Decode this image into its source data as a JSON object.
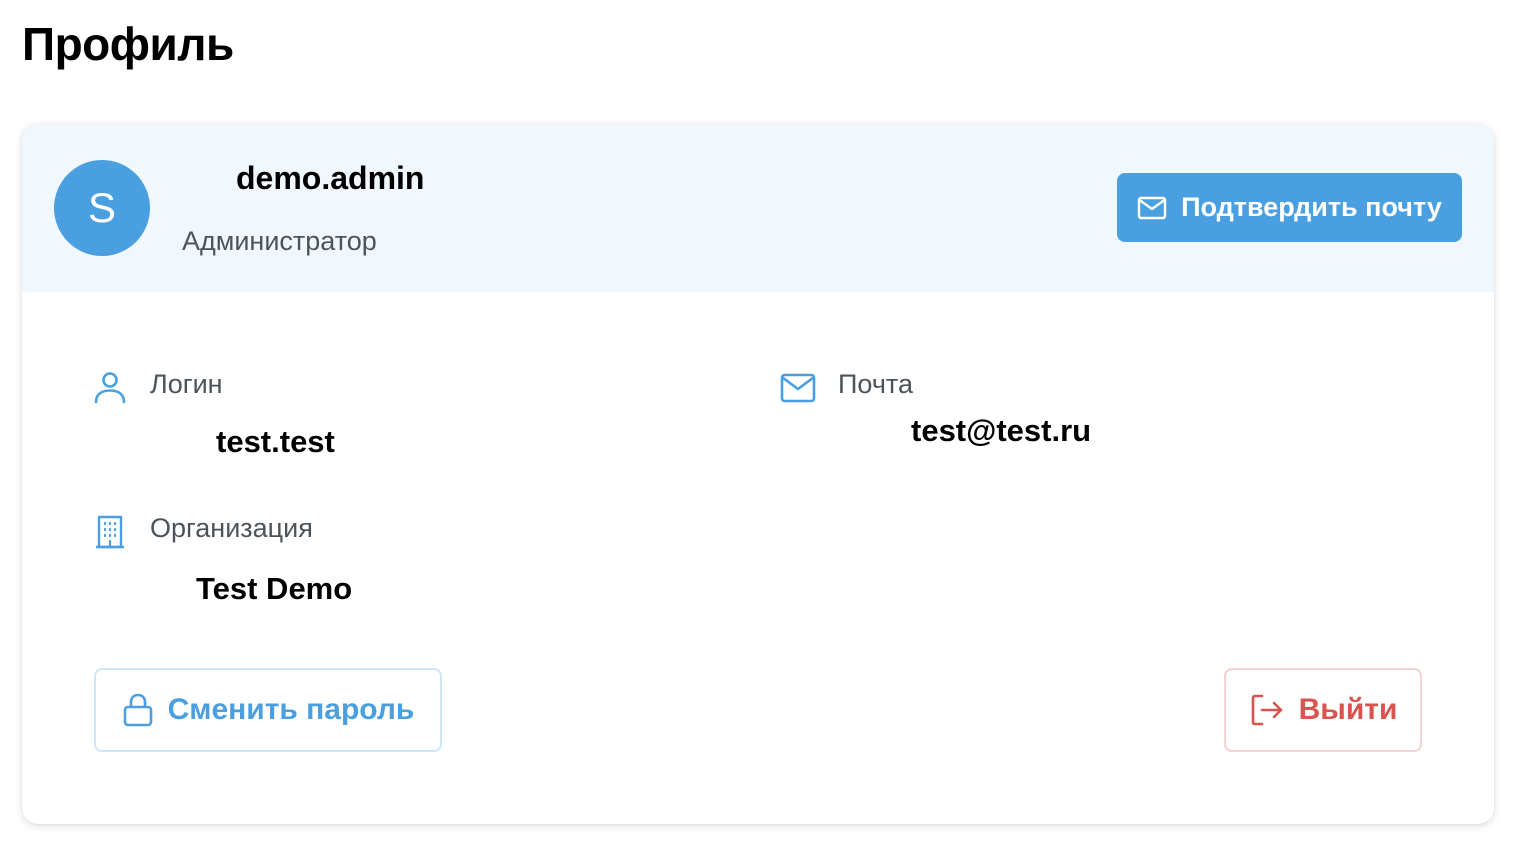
{
  "page": {
    "title": "Профиль"
  },
  "user": {
    "avatar_letter": "S",
    "username": "demo.admin",
    "role": "Администратор"
  },
  "header": {
    "confirm_email_label": "Подтвердить почту"
  },
  "fields": {
    "login": {
      "label": "Логин",
      "value": "test.test"
    },
    "email": {
      "label": "Почта",
      "value": "test@test.ru"
    },
    "organization": {
      "label": "Организация",
      "value": "Test Demo"
    }
  },
  "actions": {
    "change_password_label": "Сменить пароль",
    "logout_label": "Выйти"
  },
  "icons": {
    "confirm_button": "mail-icon",
    "login": "user-icon",
    "email": "mail-icon",
    "organization": "building-icon",
    "change_password": "lock-icon",
    "logout": "logout-icon"
  },
  "colors": {
    "accent": "#4a9fe0",
    "header_background": "#f0f7fd",
    "danger": "#d9534f",
    "muted_text": "#4d5358"
  }
}
